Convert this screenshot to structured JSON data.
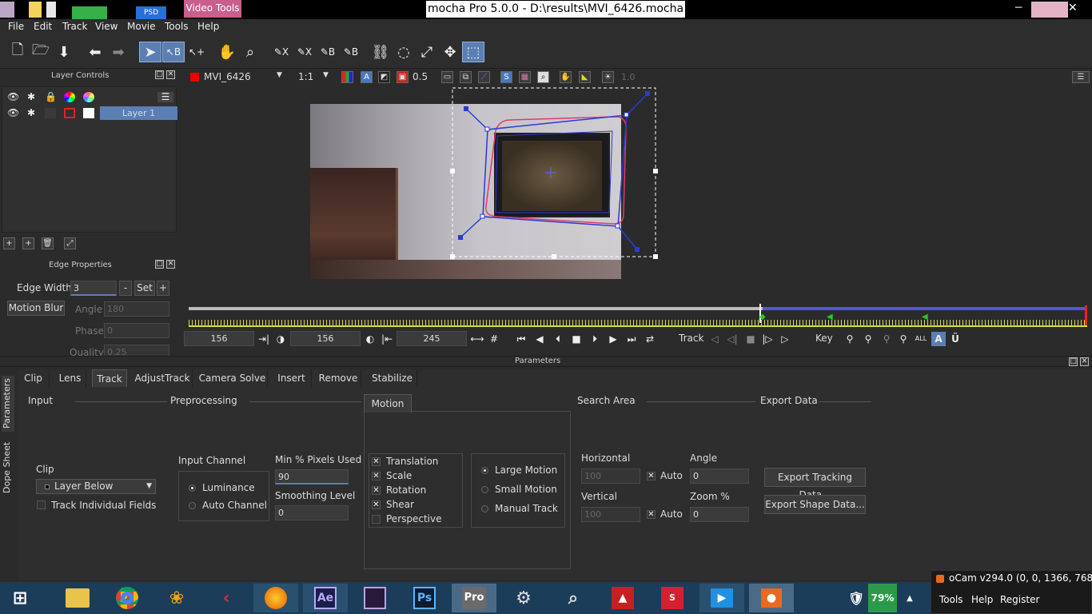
{
  "window": {
    "title": "mocha Pro 5.0.0 - D:\\results\\MVI_6426.mocha",
    "context_tab": "Video Tools",
    "psd_label": "PSD",
    "colors": {
      "context_tab": "#c85f8c",
      "selection": "#5b7fb3",
      "timeline_range": "#5555dd",
      "ticks": "#d8d84a"
    }
  },
  "menu": [
    "File",
    "Edit",
    "Track",
    "View",
    "Movie",
    "Tools",
    "Help"
  ],
  "toolbar": {
    "icons": [
      "new-file-icon",
      "open-folder-icon",
      "save-icon",
      "undo-arrow-icon",
      "redo-arrow-icon",
      "select-arrow-icon",
      "select-b-icon",
      "add-point-icon",
      "hand-icon",
      "zoom-icon",
      "pen-x-icon",
      "pen-x-spline-icon",
      "pen-b-icon",
      "pen-b-plus-icon",
      "link-icon",
      "lasso-icon",
      "transform-icon",
      "move-icon",
      "surface-icon"
    ]
  },
  "layer_controls": {
    "title": "Layer Controls",
    "layers": [
      {
        "name": "Layer 1"
      }
    ]
  },
  "edge_properties": {
    "title": "Edge Properties",
    "edge_width_label": "Edge Width",
    "edge_width_value": "3",
    "minus": "-",
    "set": "Set",
    "plus": "+",
    "motion_blur": "Motion Blur",
    "angle_label": "Angle",
    "angle_value": "180",
    "phase_label": "Phase",
    "phase_value": "0",
    "quality_label": "Quality",
    "quality_value": "0.25"
  },
  "viewer": {
    "clip": "MVI_6426",
    "zoom": "1:1",
    "opacity": "0.5",
    "exposure": "1.0"
  },
  "transport": {
    "in_frame": "156",
    "current_frame": "156",
    "out_frame": "245",
    "track_label": "Track",
    "key_label": "Key"
  },
  "parameters": {
    "title": "Parameters",
    "side_tabs": [
      "Parameters",
      "Dope Sheet"
    ],
    "tabs": [
      "Clip",
      "Lens",
      "Track",
      "AdjustTrack",
      "Camera Solve",
      "Insert",
      "Remove",
      "Stabilize"
    ],
    "active_tab": "Track",
    "input": {
      "title": "Input",
      "clip_label": "Clip",
      "clip_value": "Layer Below",
      "track_individual_fields": "Track Individual Fields"
    },
    "preprocessing": {
      "title": "Preprocessing",
      "input_channel_label": "Input Channel",
      "luminance": "Luminance",
      "auto_channel": "Auto Channel",
      "min_pixels_label": "Min % Pixels Used",
      "min_pixels_value": "90",
      "smoothing_label": "Smoothing Level",
      "smoothing_value": "0"
    },
    "motion": {
      "title": "Motion",
      "translation": "Translation",
      "scale": "Scale",
      "rotation": "Rotation",
      "shear": "Shear",
      "perspective": "Perspective",
      "large_motion": "Large Motion",
      "small_motion": "Small Motion",
      "manual_track": "Manual Track"
    },
    "search_area": {
      "title": "Search Area",
      "horizontal_label": "Horizontal",
      "horizontal_value": "100",
      "vertical_label": "Vertical",
      "vertical_value": "100",
      "auto": "Auto",
      "angle_label": "Angle",
      "angle_value": "0",
      "zoom_label": "Zoom %",
      "zoom_value": "0"
    },
    "export_data": {
      "title": "Export Data",
      "export_tracking": "Export Tracking Data...",
      "export_shape": "Export Shape Data..."
    }
  },
  "taskbar": {
    "apps": [
      "Windows",
      "File Explorer",
      "Chrome",
      "FL Studio",
      "Cubase",
      "Firefox",
      "After Effects",
      "Premiere",
      "Photoshop",
      "mocha Pro",
      "Camera",
      "Search",
      "Acrobat",
      "SketchUp",
      "Media Player",
      "oCam"
    ],
    "battery": "79%"
  },
  "ocam": {
    "title": "oCam v294.0 (0, 0, 1366, 768)",
    "menu": [
      "Tools",
      "Help",
      "Register"
    ]
  }
}
